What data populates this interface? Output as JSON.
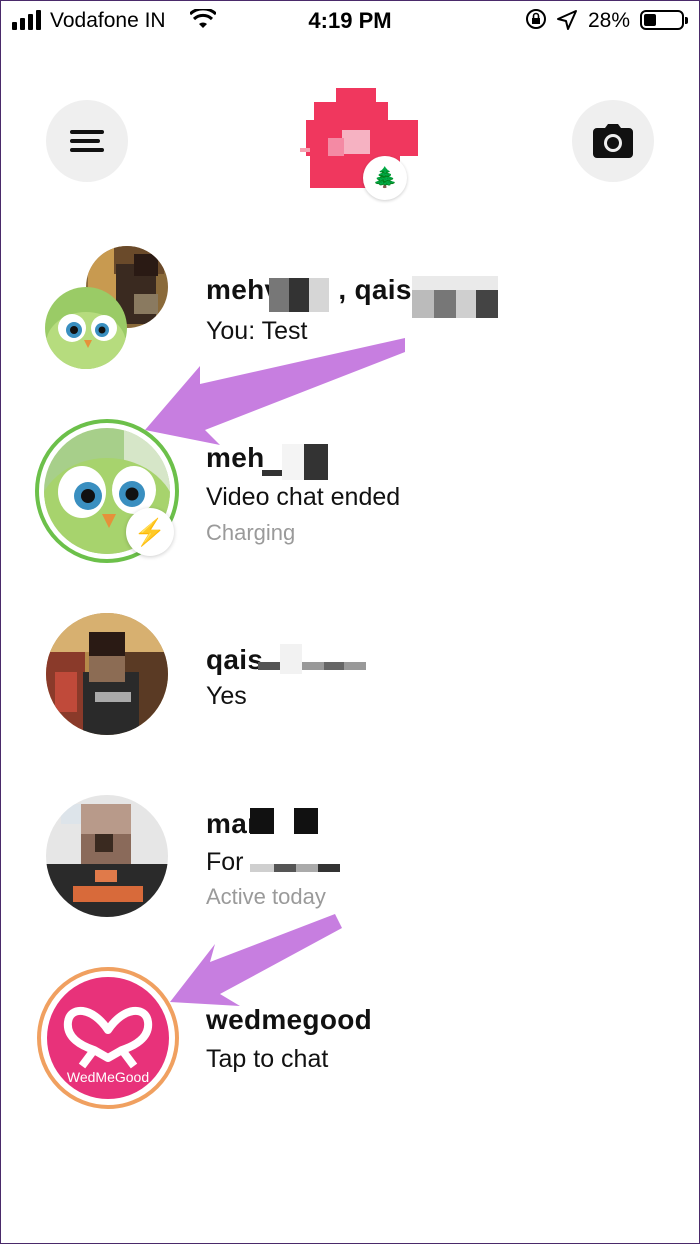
{
  "status_bar": {
    "carrier": "Vodafone IN",
    "time": "4:19 PM",
    "battery_percent": "28%"
  },
  "header": {
    "menu_icon": "hamburger-menu-icon",
    "camera_icon": "camera-icon",
    "profile_badge_icon": "tree-emoji"
  },
  "chats": [
    {
      "name_start": "mehv",
      "name_mid": ", qaisa",
      "message": "You: Test",
      "status": ""
    },
    {
      "name_start": "meh",
      "message": "Video chat ended",
      "status": "Charging"
    },
    {
      "name_start": "qais",
      "message": "Yes",
      "status": ""
    },
    {
      "name_start": "mari",
      "message": "For",
      "status": "Active today"
    },
    {
      "name_start": "wedmegood",
      "message": "Tap to chat",
      "status": "",
      "logo_text": "WedMeGood"
    }
  ],
  "colors": {
    "annotation_arrow": "#c77ee0",
    "active_ring": "#6cc04a",
    "story_ring": "#f0a060",
    "brand_pink": "#e8327a"
  }
}
